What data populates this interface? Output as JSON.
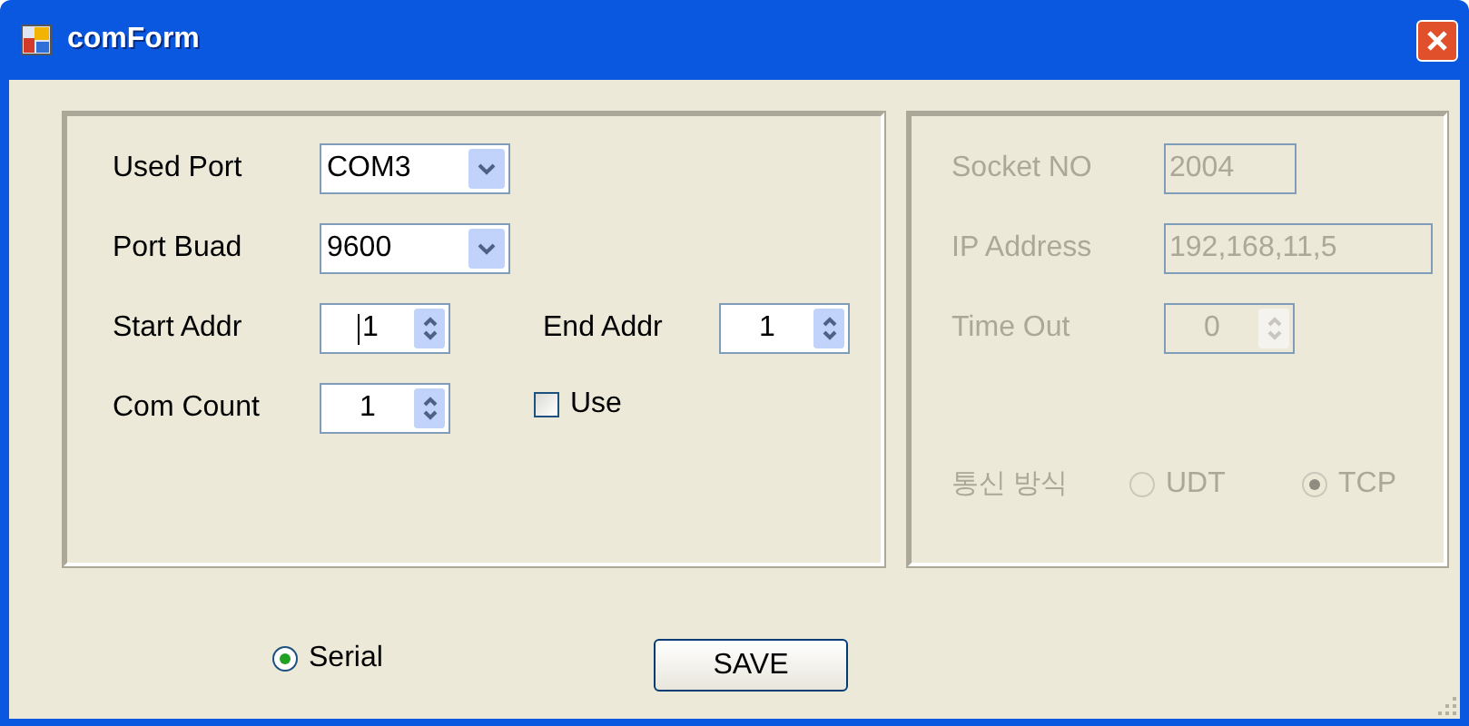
{
  "window": {
    "title": "comForm"
  },
  "serial_group": {
    "rows": [
      {
        "items": [
          {
            "kind": "combo",
            "label": "Used Port",
            "value": "COM3"
          }
        ]
      },
      {
        "items": [
          {
            "kind": "combo",
            "label": "Port Buad",
            "value": "9600"
          }
        ]
      },
      {
        "items": [
          {
            "kind": "spin",
            "label": "Start Addr",
            "value": "1",
            "focused": true
          },
          {
            "kind": "spin",
            "label": "End Addr",
            "value": "1",
            "focused": false
          }
        ]
      },
      {
        "items": [
          {
            "kind": "spin",
            "label": "Com Count",
            "value": "1",
            "focused": false
          },
          {
            "kind": "checkbox",
            "label": "Use",
            "checked": false
          }
        ]
      }
    ]
  },
  "network_group": {
    "disabled": true,
    "fields": [
      {
        "kind": "text",
        "label": "Socket NO",
        "value": "2004"
      },
      {
        "kind": "text",
        "label": "IP Address",
        "value": "192,168,11,5"
      },
      {
        "kind": "spin",
        "label": "Time Out",
        "value": "0"
      }
    ],
    "protocol": {
      "label": "통신 방식",
      "options": [
        {
          "label": "UDT",
          "selected": false
        },
        {
          "label": "TCP",
          "selected": true
        }
      ]
    }
  },
  "mode_option": {
    "label": "Serial",
    "selected": true
  },
  "save_button": "SAVE"
}
